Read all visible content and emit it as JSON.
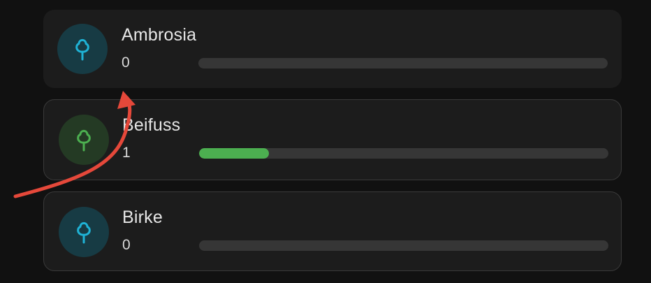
{
  "colors": {
    "tree_blue": "#1fb3d6",
    "tree_blue_bg": "#173b44",
    "tree_green": "#4caf50",
    "tree_green_bg": "#243a24",
    "bar_track": "#363636",
    "bar_fill_green": "#4caf50",
    "annotation_arrow": "#e5483a"
  },
  "allergens": [
    {
      "name": "Ambrosia",
      "value": "0",
      "level_fraction": 0.0,
      "icon": "tree-icon",
      "color": "blue"
    },
    {
      "name": "Beifuss",
      "value": "1",
      "level_fraction": 0.17,
      "icon": "tree-icon",
      "color": "green"
    },
    {
      "name": "Birke",
      "value": "0",
      "level_fraction": 0.0,
      "icon": "tree-icon",
      "color": "blue"
    }
  ]
}
